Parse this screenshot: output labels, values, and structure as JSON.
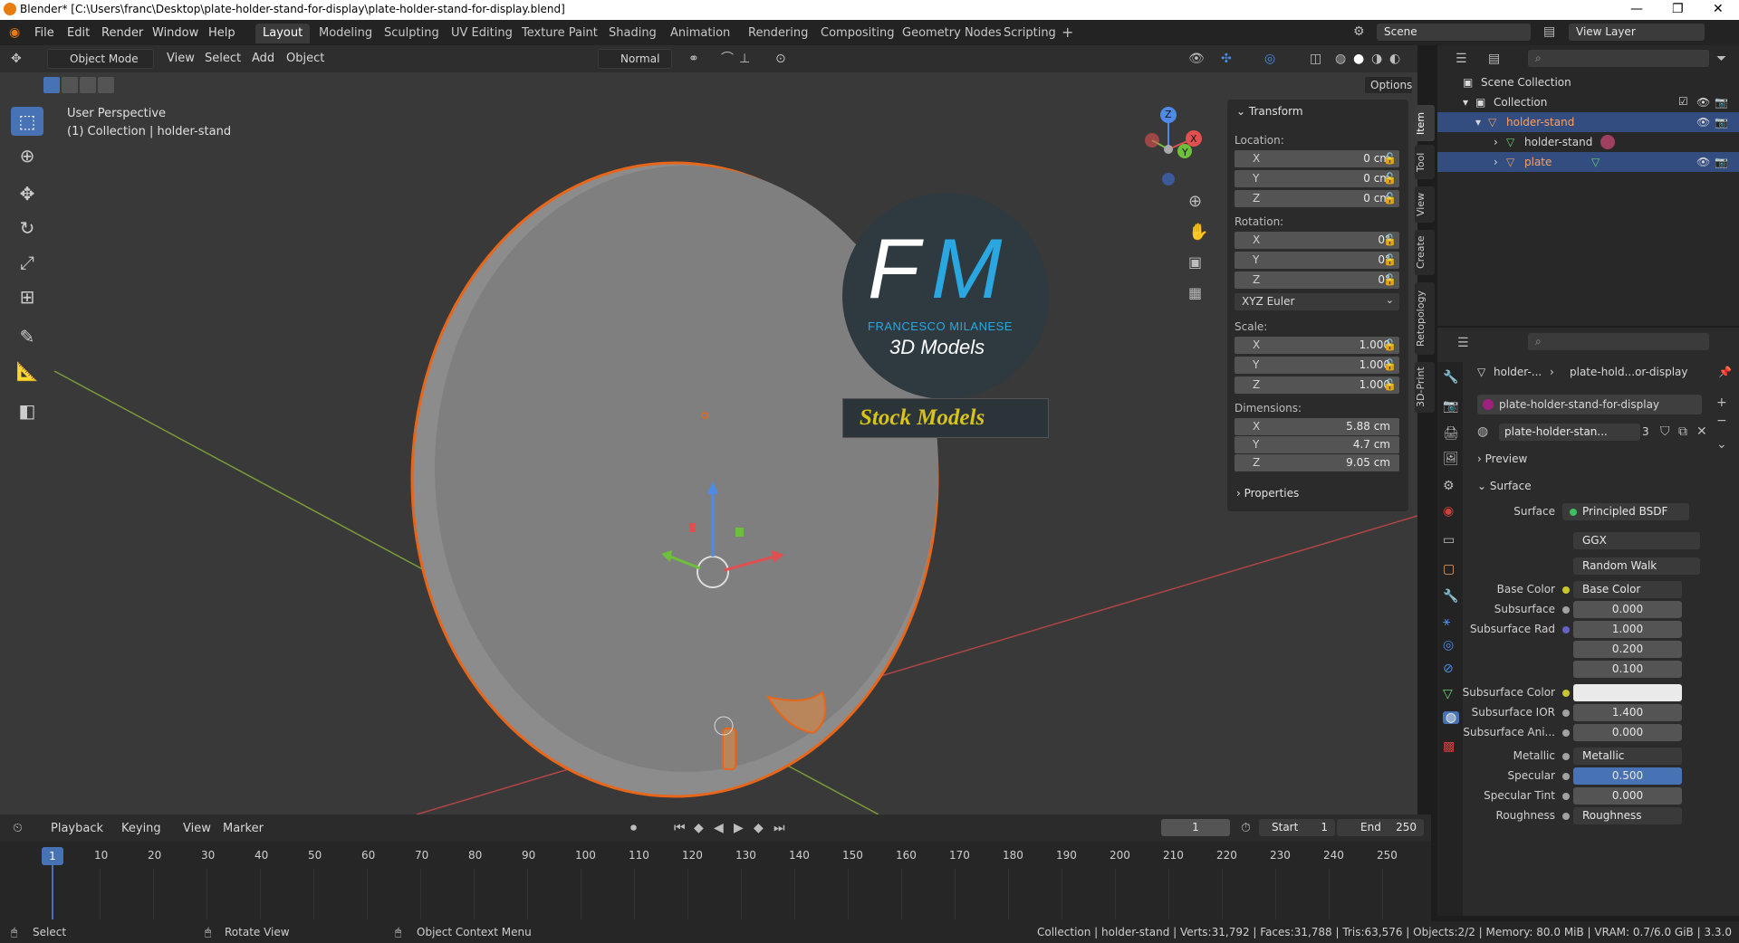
{
  "window": {
    "title": "Blender* [C:\\Users\\franc\\Desktop\\plate-holder-stand-for-display\\plate-holder-stand-for-display.blend]",
    "controls": [
      "—",
      "❐",
      "✕"
    ]
  },
  "menu": [
    "File",
    "Edit",
    "Render",
    "Window",
    "Help"
  ],
  "workspaces": [
    "Layout",
    "Modeling",
    "Sculpting",
    "UV Editing",
    "Texture Paint",
    "Shading",
    "Animation",
    "Rendering",
    "Compositing",
    "Geometry Nodes",
    "Scripting"
  ],
  "active_workspace": "Layout",
  "scene": {
    "label": "Scene",
    "view_layer": "View Layer"
  },
  "viewport_header": {
    "mode": "Object Mode",
    "menus": [
      "View",
      "Select",
      "Add",
      "Object"
    ],
    "orientation": "Normal",
    "options": "Options"
  },
  "viewport": {
    "perspective": "User Perspective",
    "collection_info": "(1) Collection | holder-stand",
    "watermark": {
      "initials_f": "F",
      "initials_m": "M",
      "name": "FRANCESCO MILANESE",
      "subtitle": "3D Models",
      "banner": "Stock Models"
    },
    "gizmo_axes": [
      "Z",
      "Y",
      "X"
    ]
  },
  "npanel": {
    "title": "Transform",
    "location_label": "Location:",
    "location": [
      {
        "axis": "X",
        "value": "0 cm"
      },
      {
        "axis": "Y",
        "value": "0 cm"
      },
      {
        "axis": "Z",
        "value": "0 cm"
      }
    ],
    "rotation_label": "Rotation:",
    "rotation": [
      {
        "axis": "X",
        "value": "0°"
      },
      {
        "axis": "Y",
        "value": "0°"
      },
      {
        "axis": "Z",
        "value": "0°"
      }
    ],
    "rotation_mode": "XYZ Euler",
    "scale_label": "Scale:",
    "scale": [
      {
        "axis": "X",
        "value": "1.000"
      },
      {
        "axis": "Y",
        "value": "1.000"
      },
      {
        "axis": "Z",
        "value": "1.000"
      }
    ],
    "dimensions_label": "Dimensions:",
    "dimensions": [
      {
        "axis": "X",
        "value": "5.88 cm"
      },
      {
        "axis": "Y",
        "value": "4.7 cm"
      },
      {
        "axis": "Z",
        "value": "9.05 cm"
      }
    ],
    "properties": "Properties"
  },
  "side_tabs": [
    "Item",
    "Tool",
    "View",
    "Create",
    "Retopology",
    "3D-Print"
  ],
  "outliner": {
    "root": "Scene Collection",
    "collection": "Collection",
    "items": [
      {
        "name": "holder-stand",
        "selected": true
      },
      {
        "name": "holder-stand",
        "selected": false
      },
      {
        "name": "plate",
        "selected": true
      }
    ]
  },
  "properties": {
    "breadcrumb_object": "holder-...",
    "breadcrumb_material": "plate-hold...or-display",
    "material_slot": "plate-holder-stand-for-display",
    "material_name": "plate-holder-stan...",
    "material_users": "3",
    "preview_label": "Preview",
    "surface_section": "Surface",
    "surface_label": "Surface",
    "surface_value": "Principled BSDF",
    "distribution": "GGX",
    "subsurface_method": "Random Walk",
    "rows": [
      {
        "label": "Base Color",
        "value": "Base Color",
        "kind": "link",
        "dot": "#c7c729"
      },
      {
        "label": "Subsurface",
        "value": "0.000",
        "kind": "num",
        "dot": "#a1a1a1"
      },
      {
        "label": "Subsurface Rad",
        "value": "1.000",
        "kind": "num",
        "dot": "#6363c7"
      },
      {
        "label": "",
        "value": "0.200",
        "kind": "num",
        "dot": ""
      },
      {
        "label": "",
        "value": "0.100",
        "kind": "num",
        "dot": ""
      },
      {
        "label": "Subsurface Color",
        "value": "",
        "kind": "color",
        "dot": "#c7c729"
      },
      {
        "label": "Subsurface IOR",
        "value": "1.400",
        "kind": "num",
        "dot": "#a1a1a1"
      },
      {
        "label": "Subsurface Ani...",
        "value": "0.000",
        "kind": "num",
        "dot": "#a1a1a1"
      },
      {
        "label": "Metallic",
        "value": "Metallic",
        "kind": "link",
        "dot": "#a1a1a1"
      },
      {
        "label": "Specular",
        "value": "0.500",
        "kind": "blue",
        "dot": "#a1a1a1"
      },
      {
        "label": "Specular Tint",
        "value": "0.000",
        "kind": "num",
        "dot": "#a1a1a1"
      },
      {
        "label": "Roughness",
        "value": "Roughness",
        "kind": "link",
        "dot": "#a1a1a1"
      }
    ]
  },
  "timeline": {
    "menus": [
      "Playback",
      "Keying",
      "View",
      "Marker"
    ],
    "current_frame": "1",
    "start_label": "Start",
    "start": "1",
    "end_label": "End",
    "end": "250",
    "ticks": [
      "10",
      "20",
      "30",
      "40",
      "50",
      "60",
      "70",
      "80",
      "90",
      "100",
      "110",
      "120",
      "130",
      "140",
      "150",
      "160",
      "170",
      "180",
      "190",
      "200",
      "210",
      "220",
      "230",
      "240",
      "250"
    ]
  },
  "status": {
    "select": "Select",
    "rotate": "Rotate View",
    "context": "Object Context Menu",
    "stats": "Collection | holder-stand | Verts:31,792 | Faces:31,788 | Tris:63,576 | Objects:2/2 | Memory: 80.0 MiB | VRAM: 0.7/6.0 GiB | 3.3.0"
  },
  "colors": {
    "accent": "#4772b3",
    "selection": "#e87d0d",
    "outliner_sel": "#334d80",
    "banner_text": "#d8c21c",
    "fm_blue": "#2aa7e0"
  }
}
